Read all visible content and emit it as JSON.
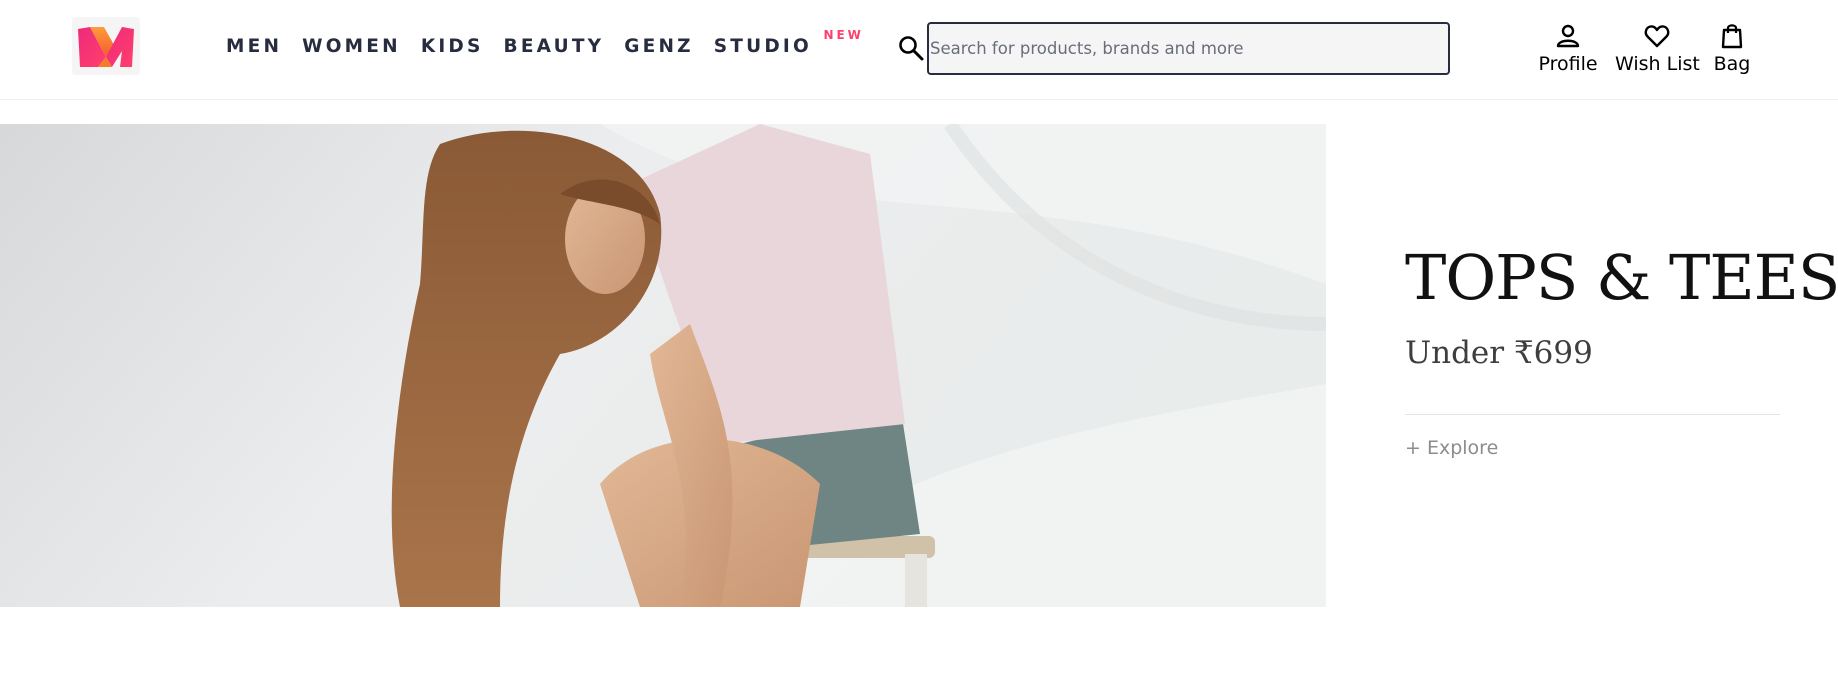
{
  "header": {
    "nav": [
      {
        "label": "MEN"
      },
      {
        "label": "WOMEN"
      },
      {
        "label": "KIDS"
      },
      {
        "label": "BEAUTY"
      },
      {
        "label": "GENZ"
      },
      {
        "label": "STUDIO",
        "badge": "NEW"
      }
    ],
    "search": {
      "placeholder": "Search for products, brands and more",
      "value": "",
      "icon": "search-icon"
    },
    "actions": [
      {
        "label": "Profile",
        "icon": "person-icon"
      },
      {
        "label": "Wish List",
        "icon": "heart-icon"
      },
      {
        "label": "Bag",
        "icon": "bag-icon"
      }
    ],
    "logo_icon": "myntra-m-logo"
  },
  "promo": {
    "title": "TOPS & TEES",
    "subtitle": "Under ₹699",
    "cta": "+ Explore"
  },
  "colors": {
    "accent": "#ff3f6c",
    "text": "#282c3f",
    "search_bg": "#f5f5f6"
  }
}
